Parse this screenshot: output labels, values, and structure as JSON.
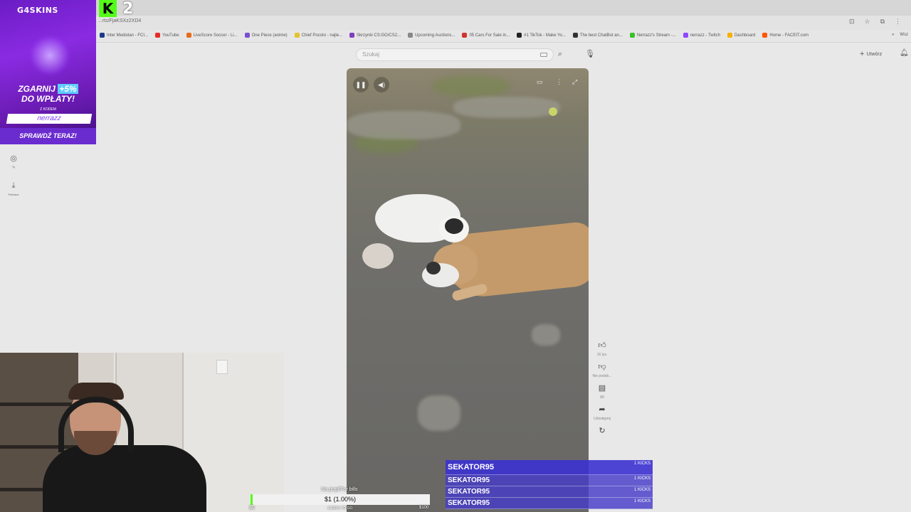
{
  "browser": {
    "url": "...rts/FjaKSXz2XD4",
    "bookmarks": [
      {
        "label": "Inter Mediolan - FCI...",
        "color": "#1a3a8a"
      },
      {
        "label": "YouTube",
        "color": "#e52d27"
      },
      {
        "label": "LiveScore Soccer - Li...",
        "color": "#e96a1a"
      },
      {
        "label": "One Piece (anime)",
        "color": "#7a4fd1"
      },
      {
        "label": "Chief Pocoto - najle...",
        "color": "#e2c42a"
      },
      {
        "label": "Skrzynki CS:GO/CS2...",
        "color": "#7f3fbf"
      },
      {
        "label": "Upcoming Auctions...",
        "color": "#888888"
      },
      {
        "label": "05 Cars For Sale in...",
        "color": "#d0342c"
      },
      {
        "label": "#1 TikTok - Make Yo...",
        "color": "#222222"
      },
      {
        "label": "The best ChatBot an...",
        "color": "#333333"
      },
      {
        "label": "Nerrazz's Stream -...",
        "color": "#3cbf2a"
      },
      {
        "label": "nerrazz - Twitch",
        "color": "#9146ff"
      },
      {
        "label": "Dashboard",
        "color": "#f5b000"
      },
      {
        "label": "Home - FACEIT.com",
        "color": "#ff5500"
      }
    ],
    "more_label": "Wsz"
  },
  "youtube": {
    "search_placeholder": "Szukaj",
    "create_label": "Utwórz",
    "sidebar": [
      {
        "icon": "account-icon",
        "label": "Ty"
      },
      {
        "icon": "download-icon",
        "label": "Pobrane"
      }
    ],
    "actions": {
      "like_count": "16 tys.",
      "dislike_label": "Nie podob...",
      "comment_count": "89",
      "share_label": "Udostępnij"
    }
  },
  "overlay": {
    "ad": {
      "brand": "G4SKINS",
      "line1_prefix": "ZGARNIJ ",
      "line1_pct": "+5%",
      "line2": "DO WPŁATY!",
      "code_label": "Z KODEM",
      "code": "nerrazz",
      "cta": "SPRAWDŹ TERAZ!"
    },
    "kick_badge": "2",
    "bills": {
      "title": "Na prąd/For bills",
      "value": "$1 (1.00%)",
      "progress": 0.01,
      "min": "$0",
      "days": "6 DAYS TO GO",
      "max": "$100"
    },
    "subs": [
      {
        "name": "SEKATOR95",
        "amount": "1 KICKS"
      },
      {
        "name": "SEKATOR95",
        "amount": "1 KICKS"
      },
      {
        "name": "SEKATOR95",
        "amount": "1 KICKS"
      },
      {
        "name": "SEKATOR95",
        "amount": "1 KICKS"
      }
    ]
  },
  "colors": {
    "kick_green": "#53fc18",
    "ad_purple": "#8a2be2",
    "subs_blue": "#4a3fd0"
  }
}
